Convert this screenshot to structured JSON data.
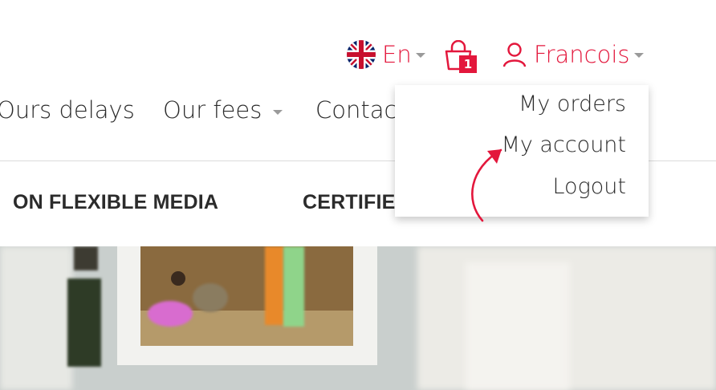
{
  "header": {
    "language": {
      "label": "En",
      "flag_icon": "uk-flag-icon"
    },
    "cart": {
      "count": "1",
      "icon": "shopping-bag-icon"
    },
    "user": {
      "name": "Francois",
      "icon": "user-icon"
    }
  },
  "nav": {
    "items": [
      {
        "label": "Ours delays"
      },
      {
        "label": "Our fees"
      },
      {
        "label": "Contact"
      }
    ]
  },
  "subnav": {
    "items": [
      {
        "label": "ON FLEXIBLE MEDIA"
      },
      {
        "label": "CERTIFIED"
      }
    ]
  },
  "user_menu": {
    "items": [
      {
        "label": "My orders"
      },
      {
        "label": "My account"
      },
      {
        "label": "Logout"
      }
    ]
  },
  "colors": {
    "accent": "#e3173c",
    "text": "#2b2b2b",
    "caret": "#9a9a9a"
  }
}
